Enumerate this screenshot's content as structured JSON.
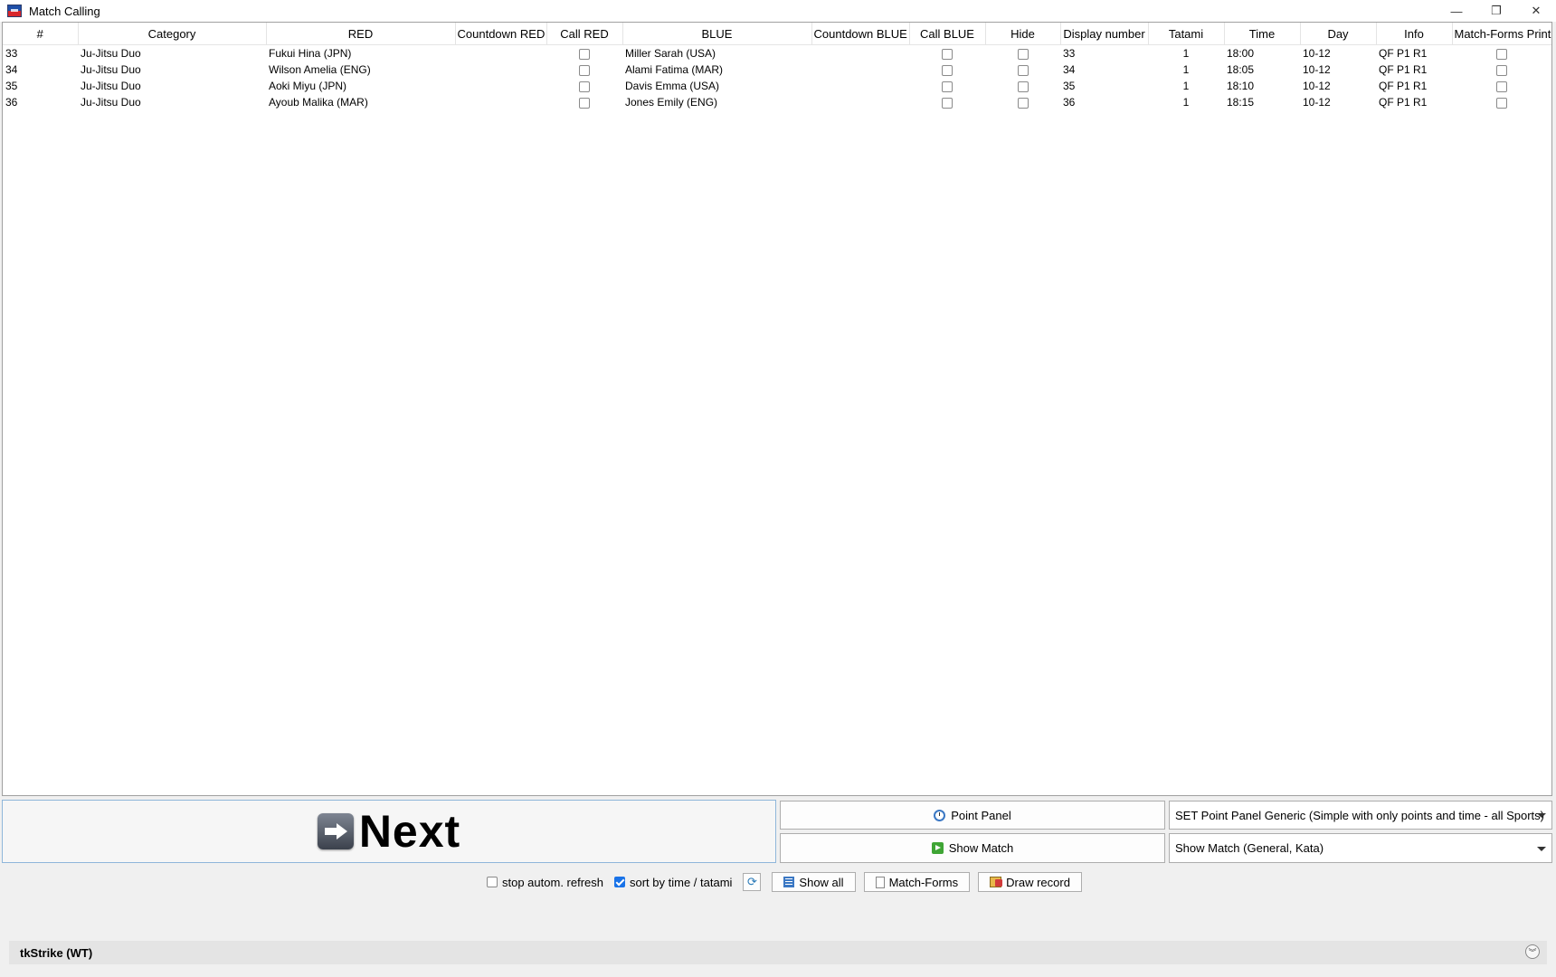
{
  "window": {
    "title": "Match Calling",
    "controls": {
      "minimize": "—",
      "restore": "❐",
      "close": "✕"
    }
  },
  "table": {
    "columns": [
      "#",
      "Category",
      "RED",
      "Countdown RED",
      "Call RED",
      "BLUE",
      "Countdown BLUE",
      "Call BLUE",
      "Hide",
      "Display number",
      "Tatami",
      "Time",
      "Day",
      "Info",
      "Match-Forms Print"
    ],
    "rows": [
      {
        "num": "33",
        "category": "Ju-Jitsu Duo",
        "red": "Fukui Hina (JPN)",
        "blue": "Miller Sarah (USA)",
        "display": "33",
        "tatami": "1",
        "time": "18:00",
        "day": "10-12",
        "info": "QF P1 R1"
      },
      {
        "num": "34",
        "category": "Ju-Jitsu Duo",
        "red": "Wilson Amelia (ENG)",
        "blue": "Alami Fatima (MAR)",
        "display": "34",
        "tatami": "1",
        "time": "18:05",
        "day": "10-12",
        "info": "QF P1 R1"
      },
      {
        "num": "35",
        "category": "Ju-Jitsu Duo",
        "red": "Aoki Miyu (JPN)",
        "blue": "Davis Emma (USA)",
        "display": "35",
        "tatami": "1",
        "time": "18:10",
        "day": "10-12",
        "info": "QF P1 R1"
      },
      {
        "num": "36",
        "category": "Ju-Jitsu Duo",
        "red": "Ayoub Malika (MAR)",
        "blue": "Jones Emily (ENG)",
        "display": "36",
        "tatami": "1",
        "time": "18:15",
        "day": "10-12",
        "info": "QF P1 R1"
      }
    ]
  },
  "controls": {
    "next_label": "Next",
    "point_panel_label": "Point Panel",
    "show_match_label": "Show Match",
    "point_panel_select": "SET Point Panel Generic (Simple with only points and time - all Sports)",
    "show_match_select": "Show Match (General, Kata)",
    "stop_refresh_label": "stop autom. refresh",
    "sort_label": "sort by time / tatami",
    "show_all_label": "Show all",
    "match_forms_label": "Match-Forms",
    "draw_record_label": "Draw record",
    "stop_refresh_checked": false,
    "sort_checked": true
  },
  "footer": {
    "label": "tkStrike (WT)"
  },
  "icons": {
    "app": "app-flag-icon",
    "next": "arrow-right-icon",
    "point_panel": "clock-icon",
    "show_match": "play-icon",
    "refresh": "refresh-icon",
    "show_all": "list-icon",
    "match_forms": "document-icon",
    "draw_record": "draw-record-icon",
    "expand": "chevron-double-down-icon"
  }
}
